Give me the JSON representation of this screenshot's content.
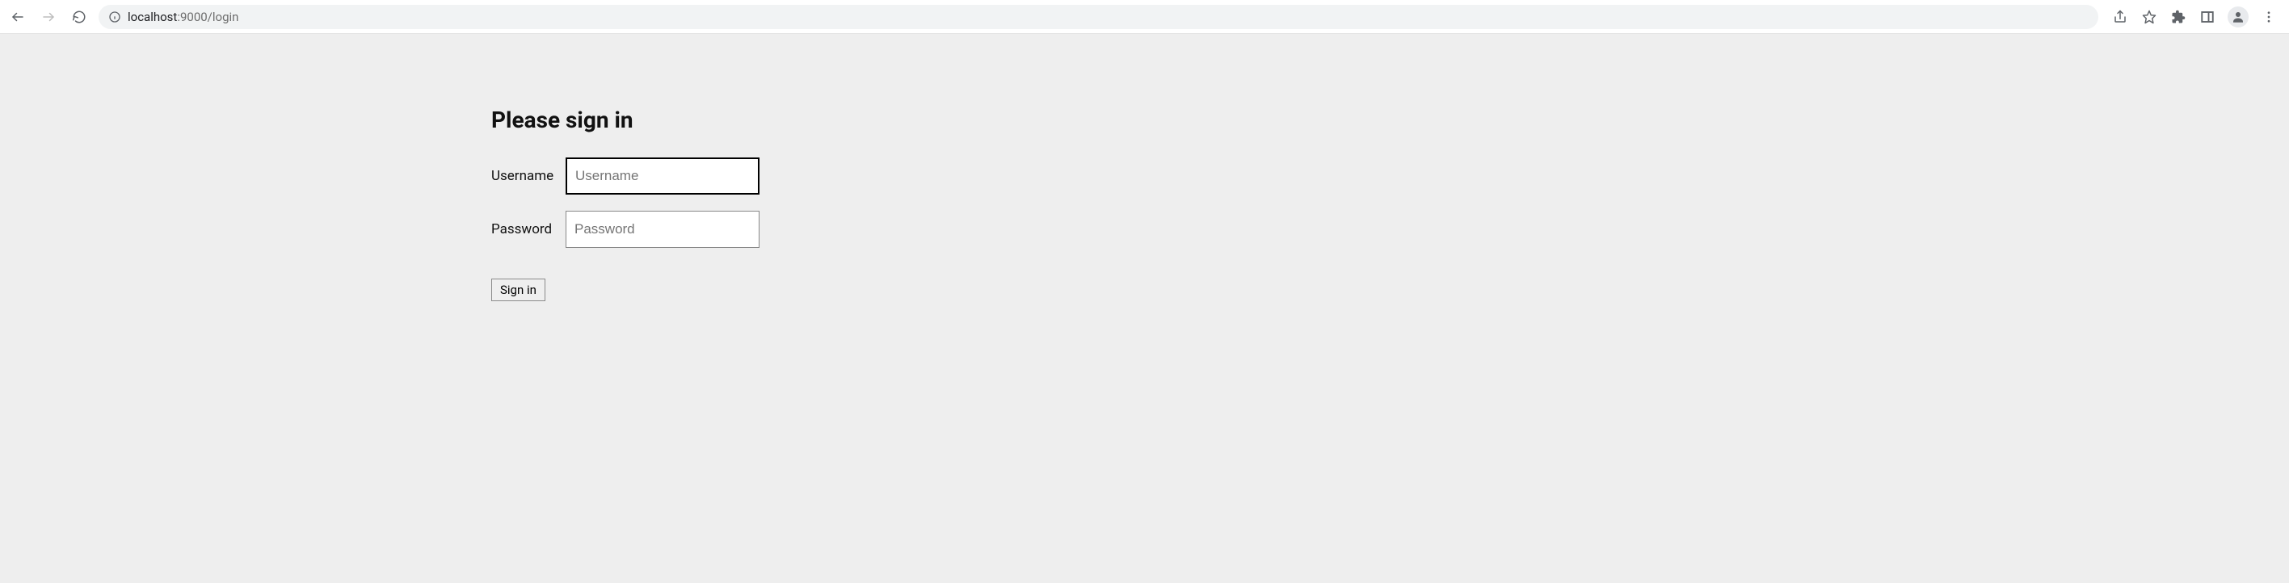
{
  "browser": {
    "url_host": "localhost",
    "url_port_path": ":9000/login"
  },
  "login": {
    "title": "Please sign in",
    "username_label": "Username",
    "username_placeholder": "Username",
    "username_value": "",
    "password_label": "Password",
    "password_placeholder": "Password",
    "password_value": "",
    "submit_label": "Sign in"
  }
}
